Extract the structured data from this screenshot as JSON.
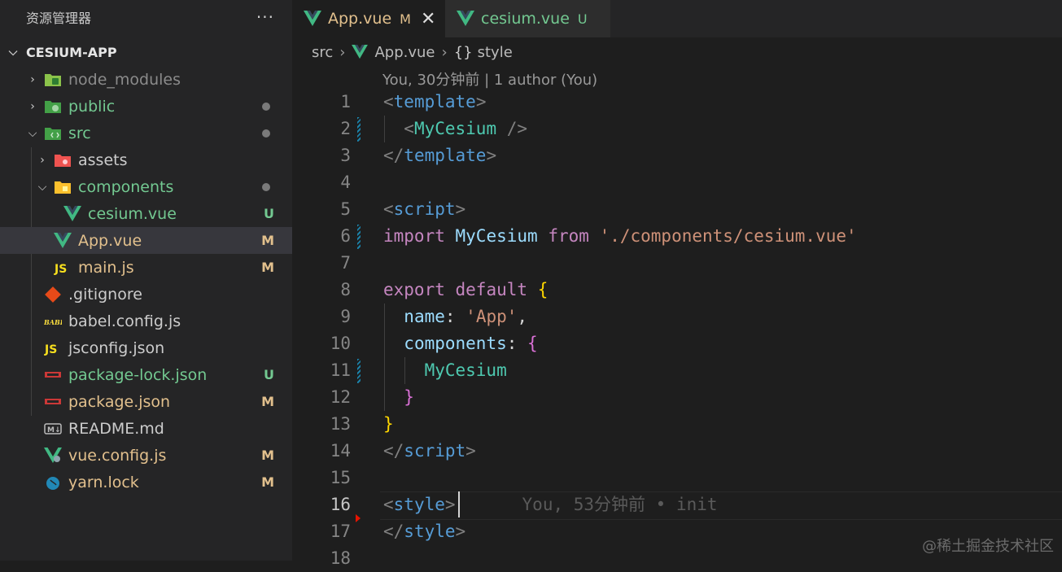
{
  "sidebar": {
    "title": "资源管理器",
    "more_label": "···",
    "section_title": "CESIUM-APP",
    "items": [
      {
        "label": "node_modules",
        "badge": "",
        "dot": false,
        "color": "#8b8b8b",
        "icon": "node-folder-icon"
      },
      {
        "label": "public",
        "badge": "",
        "dot": true,
        "color": "#73c991",
        "icon": "public-folder-icon"
      },
      {
        "label": "src",
        "badge": "",
        "dot": true,
        "color": "#73c991",
        "icon": "src-folder-icon"
      },
      {
        "label": "assets",
        "badge": "",
        "dot": false,
        "color": "#cccccc",
        "icon": "assets-folder-icon"
      },
      {
        "label": "components",
        "badge": "",
        "dot": true,
        "color": "#73c991",
        "icon": "components-folder-icon"
      },
      {
        "label": "cesium.vue",
        "badge": "U",
        "dot": false,
        "color": "#73c991",
        "icon": "vue-file-icon"
      },
      {
        "label": "App.vue",
        "badge": "M",
        "dot": false,
        "color": "#e2c08d",
        "icon": "vue-file-icon"
      },
      {
        "label": "main.js",
        "badge": "M",
        "dot": false,
        "color": "#e2c08d",
        "icon": "js-file-icon"
      },
      {
        "label": ".gitignore",
        "badge": "",
        "dot": false,
        "color": "#cccccc",
        "icon": "git-file-icon"
      },
      {
        "label": "babel.config.js",
        "badge": "",
        "dot": false,
        "color": "#cccccc",
        "icon": "babel-file-icon"
      },
      {
        "label": "jsconfig.json",
        "badge": "",
        "dot": false,
        "color": "#cccccc",
        "icon": "js-file-icon"
      },
      {
        "label": "package-lock.json",
        "badge": "U",
        "dot": false,
        "color": "#73c991",
        "icon": "npm-file-icon"
      },
      {
        "label": "package.json",
        "badge": "M",
        "dot": false,
        "color": "#e2c08d",
        "icon": "npm-file-icon"
      },
      {
        "label": "README.md",
        "badge": "",
        "dot": false,
        "color": "#cccccc",
        "icon": "markdown-file-icon"
      },
      {
        "label": "vue.config.js",
        "badge": "M",
        "dot": false,
        "color": "#e2c08d",
        "icon": "vue-config-icon"
      },
      {
        "label": "yarn.lock",
        "badge": "M",
        "dot": false,
        "color": "#e2c08d",
        "icon": "yarn-file-icon"
      }
    ]
  },
  "tabs": [
    {
      "label": "App.vue",
      "badge": "M",
      "color": "#e2c08d",
      "close": "✕"
    },
    {
      "label": "cesium.vue",
      "badge": "U",
      "color": "#73c991"
    }
  ],
  "breadcrumb": {
    "folder": "src",
    "sep": "›",
    "file": "App.vue",
    "symbol_icon": "{}",
    "symbol": "style"
  },
  "codelens": "You, 30分钟前 | 1 author (You)",
  "line_numbers": [
    "1",
    "2",
    "3",
    "4",
    "5",
    "6",
    "7",
    "8",
    "9",
    "10",
    "11",
    "12",
    "13",
    "14",
    "15",
    "16",
    "17",
    "18"
  ],
  "code": {
    "template_open": "template",
    "my_cesium_tag": "MyCesium",
    "self_close": " />",
    "template_close": "template",
    "script_open": "script",
    "kw_import": "import",
    "import_name": "MyCesium",
    "kw_from": "from",
    "import_path": "'./components/cesium.vue'",
    "kw_export": "export",
    "kw_default": "default",
    "prop_name": "name",
    "name_value": "'App'",
    "prop_components": "components",
    "component_ref": "MyCesium",
    "script_close": "script",
    "style_open": "style",
    "blame": "You, 53分钟前 • init",
    "style_close": "style"
  },
  "watermark": "@稀土掘金技术社区"
}
